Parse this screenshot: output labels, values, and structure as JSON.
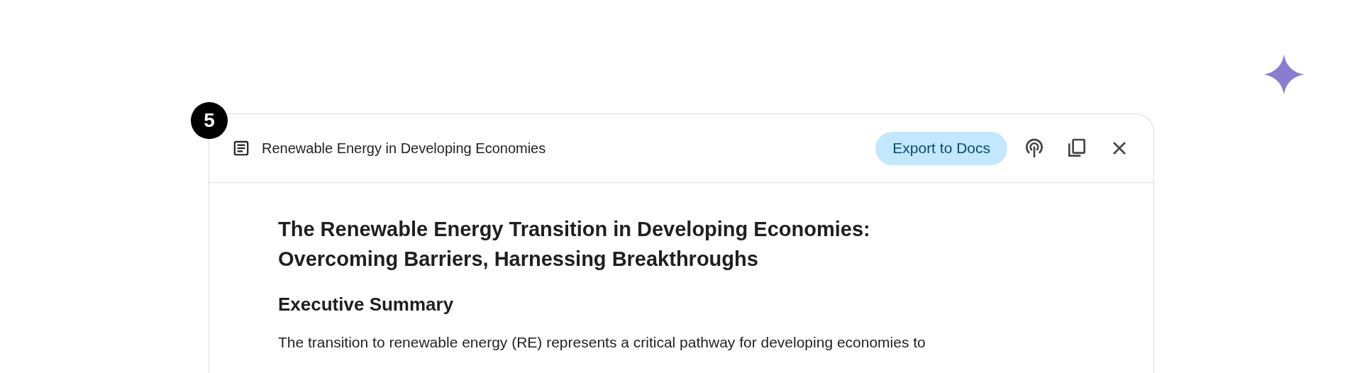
{
  "step_badge": "5",
  "panel": {
    "title": "Renewable Energy in Developing Economies",
    "export_button": "Export to Docs",
    "document": {
      "heading": "The Renewable Energy Transition in Developing Economies: Overcoming Barriers, Harnessing Breakthroughs",
      "section_heading": "Executive Summary",
      "paragraph": "The transition to renewable energy (RE) represents a critical pathway for developing economies to"
    }
  }
}
